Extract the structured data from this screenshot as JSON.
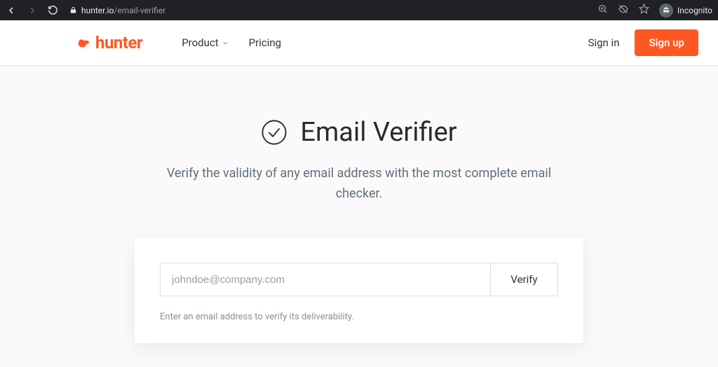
{
  "browser": {
    "url_domain": "hunter.io",
    "url_path": "/email-verifier",
    "incognito_label": "Incognito"
  },
  "brand": {
    "name": "hunter",
    "accent": "#ff5722"
  },
  "nav": {
    "product_label": "Product",
    "pricing_label": "Pricing",
    "signin_label": "Sign in",
    "signup_label": "Sign up"
  },
  "hero": {
    "title": "Email Verifier",
    "subtitle": "Verify the validity of any email address with the most complete email checker."
  },
  "form": {
    "email_placeholder": "johndoe@company.com",
    "verify_label": "Verify",
    "helper_text": "Enter an email address to verify its deliverability."
  }
}
